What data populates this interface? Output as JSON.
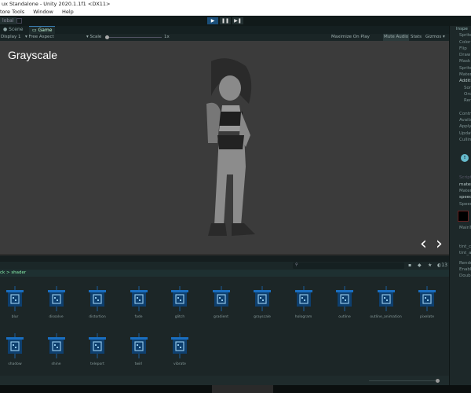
{
  "window": {
    "title": "ux Standalone - Unity 2020.1.1f1 <DX11>"
  },
  "menu": [
    "tore Tools",
    "Window",
    "Help"
  ],
  "toolbar": {
    "global_label": "lobal",
    "play": "▶",
    "pause": "❚❚",
    "step": "▶❚"
  },
  "tabs": [
    {
      "label": "Scene",
      "active": false
    },
    {
      "label": "Game",
      "active": true
    }
  ],
  "gamebar": {
    "display": "Display 1",
    "aspect": "Free Aspect",
    "scale_label": "Scale",
    "scale_value": "1x",
    "maximize": "Maximize On Play",
    "mute": "Mute Audio",
    "stats": "Stats",
    "gizmos": "Gizmos"
  },
  "game": {
    "effect_title": "Grayscale",
    "prev": "‹",
    "next": "›"
  },
  "inspector": {
    "tab": "Inspe",
    "rows": [
      "Sprite",
      "Color",
      "Flip",
      "Draw",
      "Mask",
      "Sprite",
      "Mater",
      "Additi",
      "Sor",
      "Ord",
      "Ren",
      "",
      "Contro",
      "Availa",
      "Apply",
      "Updat",
      "Cullin",
      "",
      "",
      "",
      "",
      "",
      "",
      "Script",
      "mater",
      "Materi",
      "speed",
      "Speed",
      "",
      "",
      "",
      "MainT",
      "",
      "",
      "",
      "tint_co",
      "tint_an",
      "",
      "Rende",
      "Enable",
      "Double"
    ]
  },
  "project": {
    "breadcrumb": "ck > shader",
    "count": "13",
    "search_placeholder": ""
  },
  "assets": [
    "blur",
    "dissolve",
    "distortion",
    "fade",
    "glitch",
    "gradient",
    "grayscale",
    "hologram",
    "outline",
    "outline_animation",
    "pixelate",
    "shadow",
    "shine",
    "teleport",
    "twirl",
    "vibrate"
  ],
  "colors": {
    "accent": "#1a66a8",
    "game_bg": "#3b3b3b",
    "editor_bg": "#1c2627"
  }
}
